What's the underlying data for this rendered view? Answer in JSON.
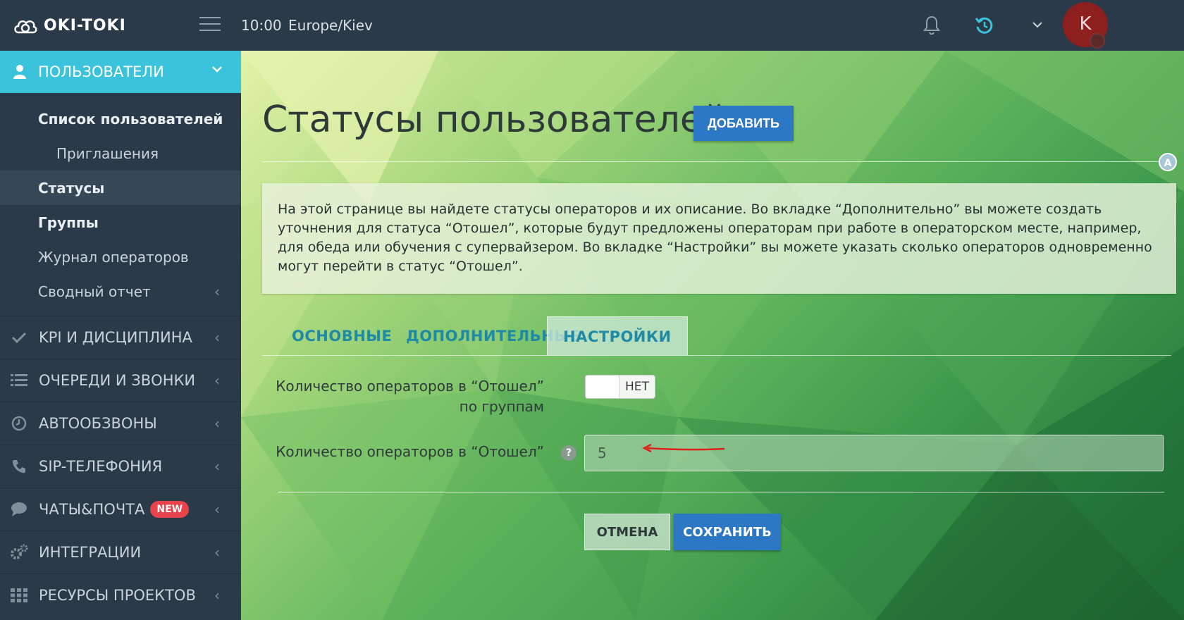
{
  "topbar": {
    "logo_text": "OKI-TOKI",
    "time": "10:00",
    "timezone": "Europe/Kiev",
    "avatar_letter": "K"
  },
  "sidebar": {
    "header_label": "ПОЛЬЗОВАТЕЛИ",
    "sub_items": [
      {
        "label": "Список пользователей"
      },
      {
        "label": "Приглашения"
      },
      {
        "label": "Статусы"
      },
      {
        "label": "Группы"
      },
      {
        "label": "Журнал операторов"
      },
      {
        "label": "Сводный отчет"
      }
    ],
    "sections": [
      {
        "label": "KPI И ДИСЦИПЛИНА",
        "icon": "check-icon"
      },
      {
        "label": "ОЧЕРЕДИ И ЗВОНКИ",
        "icon": "list-icon"
      },
      {
        "label": "АВТООБЗВОНЫ",
        "icon": "clock-icon"
      },
      {
        "label": "SIP-ТЕЛЕФОНИЯ",
        "icon": "phone-icon"
      },
      {
        "label": "ЧАТЫ&ПОЧТА",
        "icon": "chat-icon",
        "badge": "NEW"
      },
      {
        "label": "ИНТЕГРАЦИИ",
        "icon": "gears-icon"
      },
      {
        "label": "РЕСУРСЫ ПРОЕКТОВ",
        "icon": "grid-icon"
      }
    ]
  },
  "main": {
    "title": "Статусы пользователей",
    "add_button": "ДОБАВИТЬ",
    "a_marker": "A",
    "info_text": "На этой странице вы найдете статусы операторов и их описание. Во вкладке “Дополнительно” вы можете создать уточнения для статуса “Отошел”, которые будут предложены операторам при работе в операторском месте, например, для обеда или обучения с супервайзером. Во вкладке “Настройки” вы можете указать сколько операторов одновременно могут перейти в статус “Отошел”.",
    "tabs": [
      {
        "label": "ОСНОВНЫЕ"
      },
      {
        "label": "ДОПОЛНИТЕЛЬНЫЕ"
      },
      {
        "label": "НАСТРОЙКИ"
      }
    ],
    "active_tab": "НАСТРОЙКИ",
    "field1_label": "Количество операторов в “Отошел” по группам",
    "toggle_text": "НЕТ",
    "field2_label": "Количество операторов в “Отошел”",
    "help_symbol": "?",
    "field2_value": "5",
    "cancel_button": "ОТМЕНА",
    "save_button": "СОХРАНИТЬ"
  },
  "colors": {
    "sidebar_bg": "#2b3a48",
    "accent": "#3cc3dc",
    "primary_button": "#2c78c5",
    "badge_new": "#e8424b",
    "avatar": "#8e1f1f",
    "arrow": "#e0201b"
  }
}
